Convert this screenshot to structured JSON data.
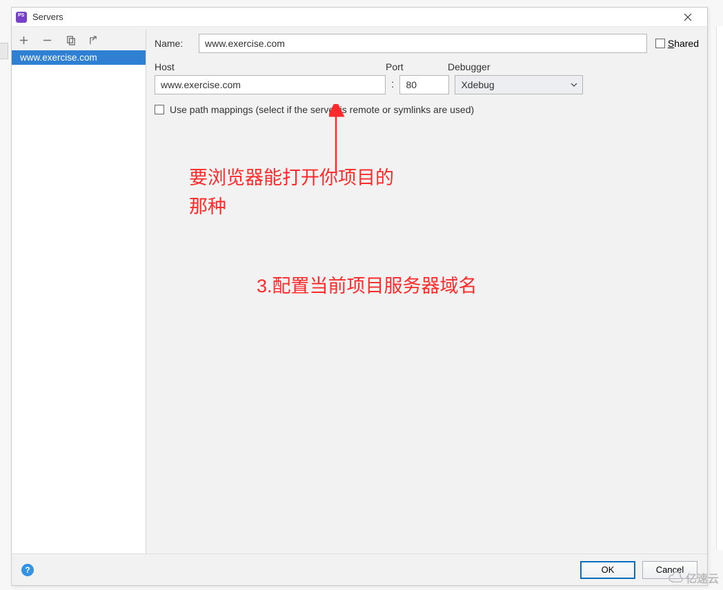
{
  "window": {
    "title": "Servers"
  },
  "sidebar": {
    "selected_label": "www.exercise.com"
  },
  "form": {
    "name_label": "Name:",
    "name_value": "www.exercise.com",
    "shared_label_pre": "S",
    "shared_label_post": "hared",
    "host_header": "Host",
    "port_header": "Port",
    "debugger_header": "Debugger",
    "host_value": "www.exercise.com",
    "port_value": "80",
    "debugger_value": "Xdebug",
    "path_mappings_label": "Use path mappings (select if the server is remote or symlinks are used)"
  },
  "annotations": {
    "line1": "要浏览器能打开你项目的",
    "line2": "那种",
    "line3": "3.配置当前项目服务器域名"
  },
  "footer": {
    "ok": "OK",
    "cancel": "Cancel"
  },
  "watermark": "亿速云"
}
